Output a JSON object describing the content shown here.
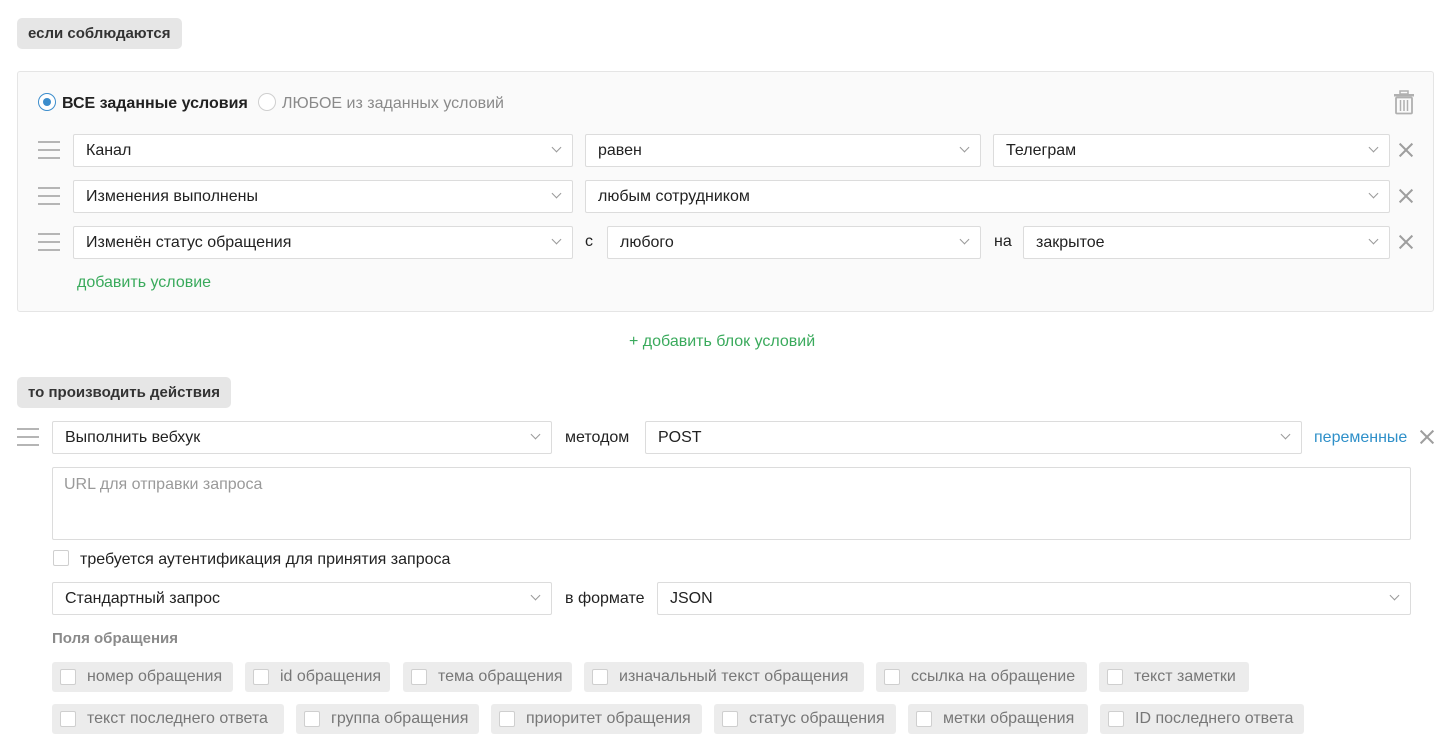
{
  "conditions": {
    "header": "если соблюдаются",
    "mode_all": "ВСЕ заданные условия",
    "mode_any": "ЛЮБОЕ из заданных условий",
    "rows": [
      {
        "field": "Канал",
        "operator": "равен",
        "value": "Телеграм"
      },
      {
        "field": "Изменения выполнены",
        "operator": "любым сотрудником"
      },
      {
        "field": "Изменён статус обращения",
        "from_label": "с",
        "from": "любого",
        "to_label": "на",
        "to": "закрытое"
      }
    ],
    "add_condition": "добавить условие"
  },
  "add_block": "+ добавить блок условий",
  "actions": {
    "header": "то производить действия",
    "action": "Выполнить вебхук",
    "method_label": "методом",
    "method": "POST",
    "variables_link": "переменные",
    "url_placeholder": "URL для отправки запроса",
    "auth_label": "требуется аутентификация для принятия запроса",
    "request_type": "Стандартный запрос",
    "format_label": "в формате",
    "format": "JSON",
    "fields_title": "Поля обращения",
    "fields": [
      "номер обращения",
      "id обращения",
      "тема обращения",
      "изначальный текст обращения",
      "ссылка на обращение",
      "текст заметки",
      "текст последнего ответа",
      "группа обращения",
      "приоритет обращения",
      "статус обращения",
      "метки обращения",
      "ID последнего ответа"
    ]
  }
}
